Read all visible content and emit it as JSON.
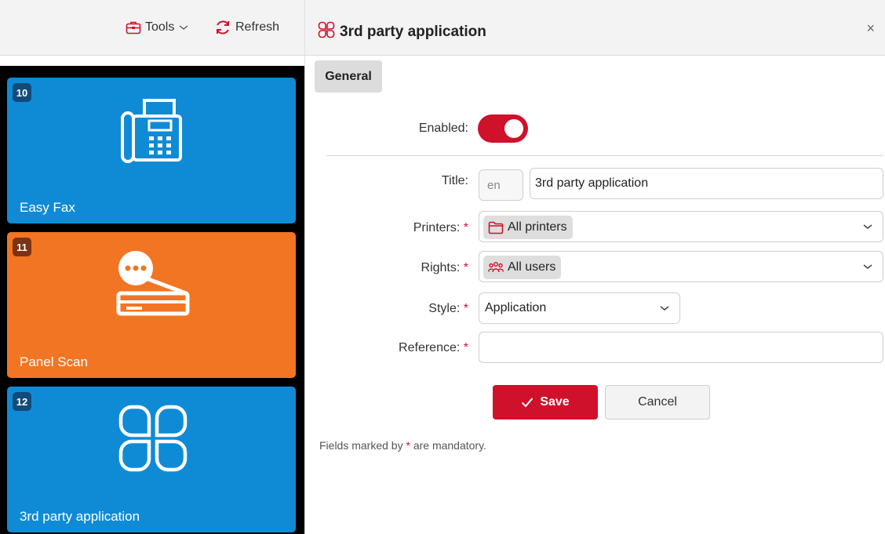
{
  "toolbar": {
    "tools_label": "Tools",
    "tools_icon": "toolbox-icon",
    "refresh_label": "Refresh",
    "refresh_icon": "refresh-icon"
  },
  "tiles": [
    {
      "number": "10",
      "label": "Easy Fax",
      "icon": "fax-icon",
      "color": "#0f8bd6",
      "number_bg": "#124a7a"
    },
    {
      "number": "11",
      "label": "Panel Scan",
      "icon": "scanner-icon",
      "color": "#f27523",
      "number_bg": "#7a3315"
    },
    {
      "number": "12",
      "label": "3rd party application",
      "icon": "apps-grid-icon",
      "color": "#0f8bd6",
      "number_bg": "#124a7a"
    }
  ],
  "dialog": {
    "title": "3rd party application",
    "title_icon": "apps-grid-icon",
    "close_label": "×",
    "tabs": [
      {
        "label": "General",
        "active": true
      }
    ],
    "fields": {
      "enabled": {
        "label": "Enabled:",
        "value": true
      },
      "title": {
        "label": "Title:",
        "lang": "en",
        "value": "3rd party application"
      },
      "printers": {
        "label": "Printers:",
        "required_mark": "*",
        "chip": "All printers",
        "chip_icon": "folder-icon"
      },
      "rights": {
        "label": "Rights:",
        "required_mark": "*",
        "chip": "All users",
        "chip_icon": "users-icon"
      },
      "style": {
        "label": "Style:",
        "required_mark": "*",
        "value": "Application"
      },
      "reference": {
        "label": "Reference:",
        "required_mark": "*",
        "value": ""
      }
    },
    "save_label": "Save",
    "cancel_label": "Cancel",
    "note_prefix": "Fields marked by ",
    "note_mark": "*",
    "note_suffix": " are mandatory."
  },
  "colors": {
    "accent": "#d0112b",
    "tile_blue": "#0f8bd6",
    "tile_orange": "#f27523"
  }
}
